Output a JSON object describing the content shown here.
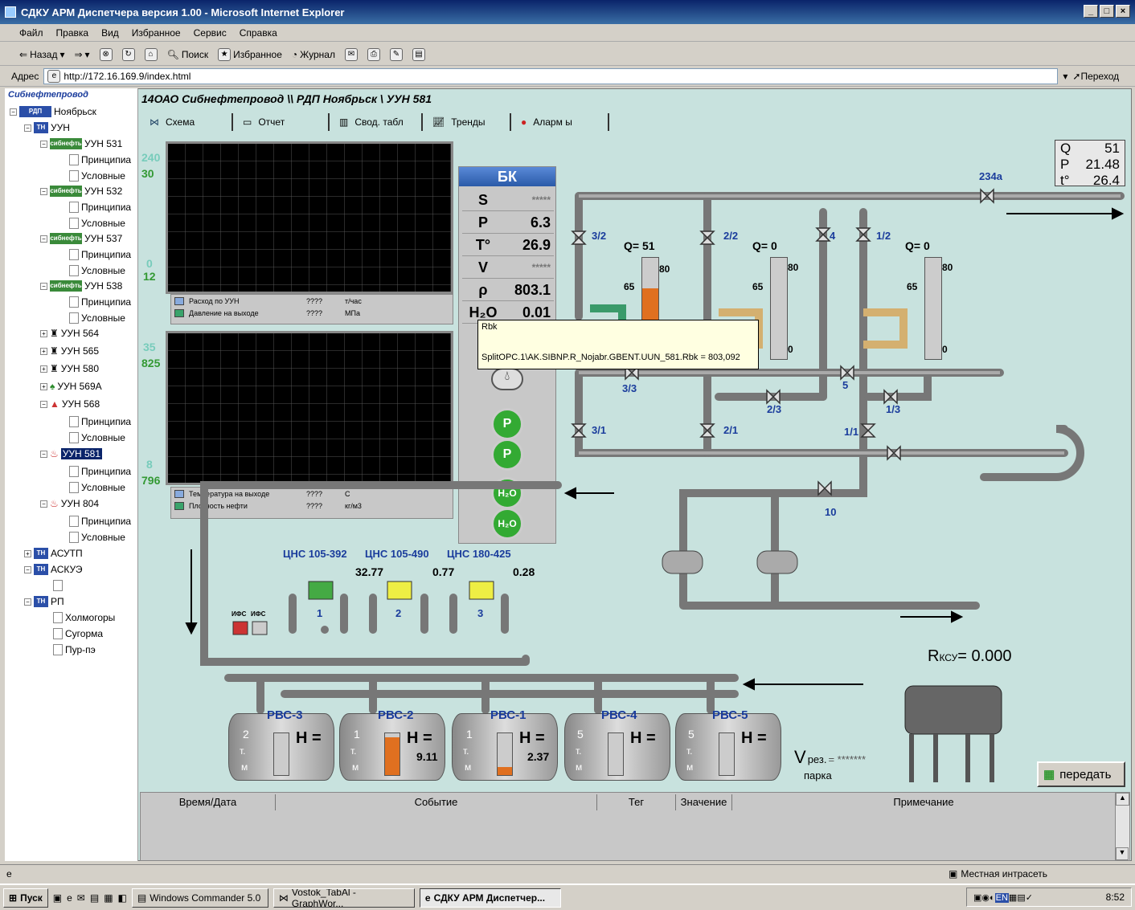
{
  "window": {
    "title": "СДКУ АРМ Диспетчера версия 1.00 - Microsoft Internet Explorer"
  },
  "menu": [
    "Файл",
    "Правка",
    "Вид",
    "Избранное",
    "Сервис",
    "Справка"
  ],
  "toolbar": {
    "back": "Назад",
    "search": "Поиск",
    "favorites": "Избранное",
    "history": "Журнал"
  },
  "address": {
    "label": "Адрес",
    "url": "http://172.16.169.9/index.html",
    "go": "Переход"
  },
  "tree": {
    "root": "Сибнефтепровод",
    "rdp": "Ноябрьск",
    "uun": "УУН",
    "items": [
      {
        "label": "УУН 531",
        "sub": [
          "Принципиа",
          "Условные"
        ]
      },
      {
        "label": "УУН 532",
        "sub": [
          "Принципиа",
          "Условные"
        ]
      },
      {
        "label": "УУН 537",
        "sub": [
          "Принципиа",
          "Условные"
        ]
      },
      {
        "label": "УУН 538",
        "sub": [
          "Принципиа",
          "Условные"
        ]
      }
    ],
    "collapsed": [
      "УУН 564",
      "УУН 565",
      "УУН 580",
      "УУН 569А"
    ],
    "uun568": {
      "label": "УУН 568",
      "sub": [
        "Принципиа",
        "Условные"
      ]
    },
    "uun581": {
      "label": "УУН 581",
      "sub": [
        "Принципиа",
        "Условные"
      ]
    },
    "uun804": {
      "label": "УУН 804",
      "sub": [
        "Принципиа",
        "Условные"
      ]
    },
    "asutp": "АСУТП",
    "askue": "АСКУЭ",
    "rp": "РП",
    "rp_items": [
      "Холмогоры",
      "Сугорма",
      "Пур-пэ"
    ]
  },
  "main": {
    "title": "14ОАО Сибнефтепровод \\\\ РДП Ноябрьск \\ УУН 581",
    "tabs": [
      "Схема",
      "Отчет",
      "Свод. табл",
      "Тренды",
      "Аларм ы"
    ]
  },
  "trend1": {
    "scale_top": "240",
    "scale_mid": "30",
    "scale_zero": "0",
    "scale_low": "12",
    "legend": [
      {
        "name": "Расход по УУН",
        "value": "????",
        "unit": "т/час"
      },
      {
        "name": "Давление на выходе",
        "value": "????",
        "unit": "МПа"
      }
    ]
  },
  "trend2": {
    "scale_top": "35",
    "scale_mid": "825",
    "scale_zero": "8",
    "scale_low": "796",
    "legend": [
      {
        "name": "Температура на выходе",
        "value": "????",
        "unit": "С"
      },
      {
        "name": "Плотность нефти",
        "value": "????",
        "unit": "кг/м3"
      }
    ]
  },
  "bk": {
    "title": "БК",
    "rows": [
      {
        "label": "S",
        "value": "*****"
      },
      {
        "label": "P",
        "value": "6.3"
      },
      {
        "label": "T°",
        "value": "26.9"
      },
      {
        "label": "V",
        "value": "*****"
      },
      {
        "label": "ρ",
        "value": "803.1"
      },
      {
        "label": "H₂O",
        "value": "0.01"
      }
    ]
  },
  "tooltip": {
    "line1": "Rbk",
    "line2": "SplitOPC.1\\AK.SIBNP.R_Nojabr.GBENT.UUN_581.Rbk = 803,092"
  },
  "qpt": {
    "q_label": "Q",
    "q": "51",
    "p_label": "P",
    "p": "21.48",
    "t_label": "t°",
    "t": "26.4"
  },
  "valves": [
    "234а",
    "3/2",
    "2/2",
    "4",
    "1/2",
    "3/3",
    "5",
    "2/3",
    "1/3",
    "3/1",
    "2/1",
    "1/1",
    "10"
  ],
  "lines": [
    {
      "q": "Q= 51"
    },
    {
      "q": "Q= 0"
    },
    {
      "q": "Q= 0"
    }
  ],
  "gauge_labels": {
    "top": "80",
    "mid": "65",
    "zero": "0"
  },
  "pumps": [
    {
      "name": "ЦНС 105-392",
      "value": "32.77",
      "num": "1"
    },
    {
      "name": "ЦНС 105-490",
      "value": "0.77",
      "num": "2"
    },
    {
      "name": "ЦНС 180-425",
      "value": "0.28",
      "num": "3"
    }
  ],
  "ifs": [
    "ИФС",
    "ИФС"
  ],
  "rksu": {
    "label": "R",
    "sub": "КСУ",
    "value": "= 0.000"
  },
  "tanks": [
    {
      "name": "РВС-3",
      "num": "2",
      "h": "",
      "level": 0
    },
    {
      "name": "РВС-2",
      "num": "1",
      "h": "9.11",
      "level": 0.9
    },
    {
      "name": "РВС-1",
      "num": "1",
      "h": "2.37",
      "level": 0.2
    },
    {
      "name": "РВС-4",
      "num": "5",
      "h": "",
      "level": 0
    },
    {
      "name": "РВС-5",
      "num": "5",
      "h": "",
      "level": 0
    }
  ],
  "tank_labels": {
    "h": "H =",
    "t": "т.",
    "m": "м"
  },
  "vrez": {
    "label": "V",
    "sub": "рез.",
    "eq": "= *******",
    "park": "парка"
  },
  "send_button": "передать",
  "events": {
    "cols": [
      "Время/Дата",
      "Событие",
      "Тег",
      "Значение",
      "Примечание"
    ]
  },
  "status": {
    "zone": "Местная интрасеть"
  },
  "taskbar": {
    "start": "Пуск",
    "tasks": [
      "Windows Commander 5.0",
      "Vostok_TabAl - GraphWor...",
      "СДКУ АРМ Диспетчер..."
    ],
    "clock": "8:52"
  }
}
